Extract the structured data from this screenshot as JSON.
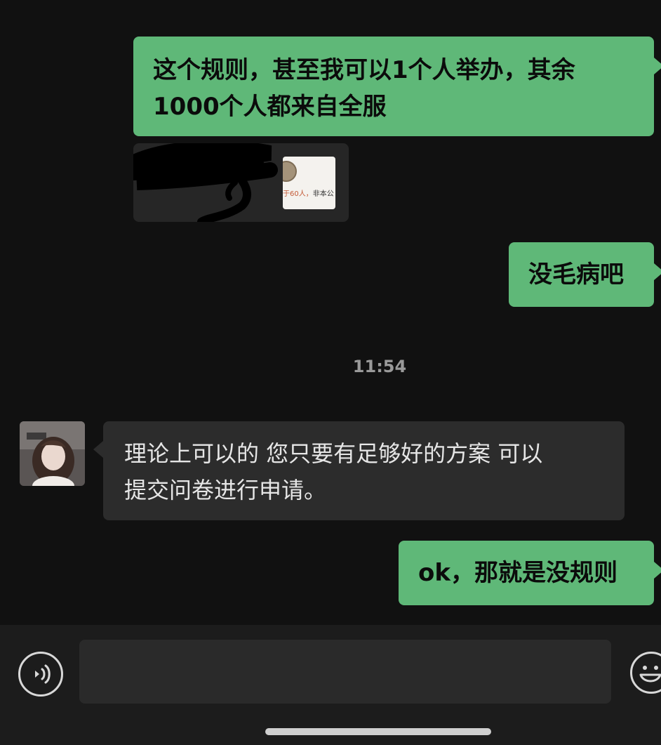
{
  "messages": [
    {
      "id": "m1",
      "direction": "outgoing",
      "lines": [
        "这个规则，甚至我可以1个人举办，其余",
        "1000个人都来自全服"
      ]
    },
    {
      "id": "m2",
      "direction": "outgoing",
      "type": "shared-card",
      "preview_text_highlight": "于60人，",
      "preview_text": "非本公"
    },
    {
      "id": "m3",
      "direction": "outgoing",
      "text": "没毛病吧"
    },
    {
      "id": "m4",
      "direction": "incoming",
      "lines": [
        "理论上可以的 您只要有足够好的方案 可以",
        "提交问卷进行申请。"
      ]
    },
    {
      "id": "m5",
      "direction": "outgoing",
      "text": "ok，那就是没规则"
    }
  ],
  "timestamp": "11:54",
  "input": {
    "value": ""
  },
  "icons": {
    "voice": "voice-icon",
    "emoji": "emoji-icon"
  },
  "colors": {
    "outgoing_bubble": "#5fb878",
    "incoming_bubble": "#2c2c2c",
    "background": "#111111"
  }
}
